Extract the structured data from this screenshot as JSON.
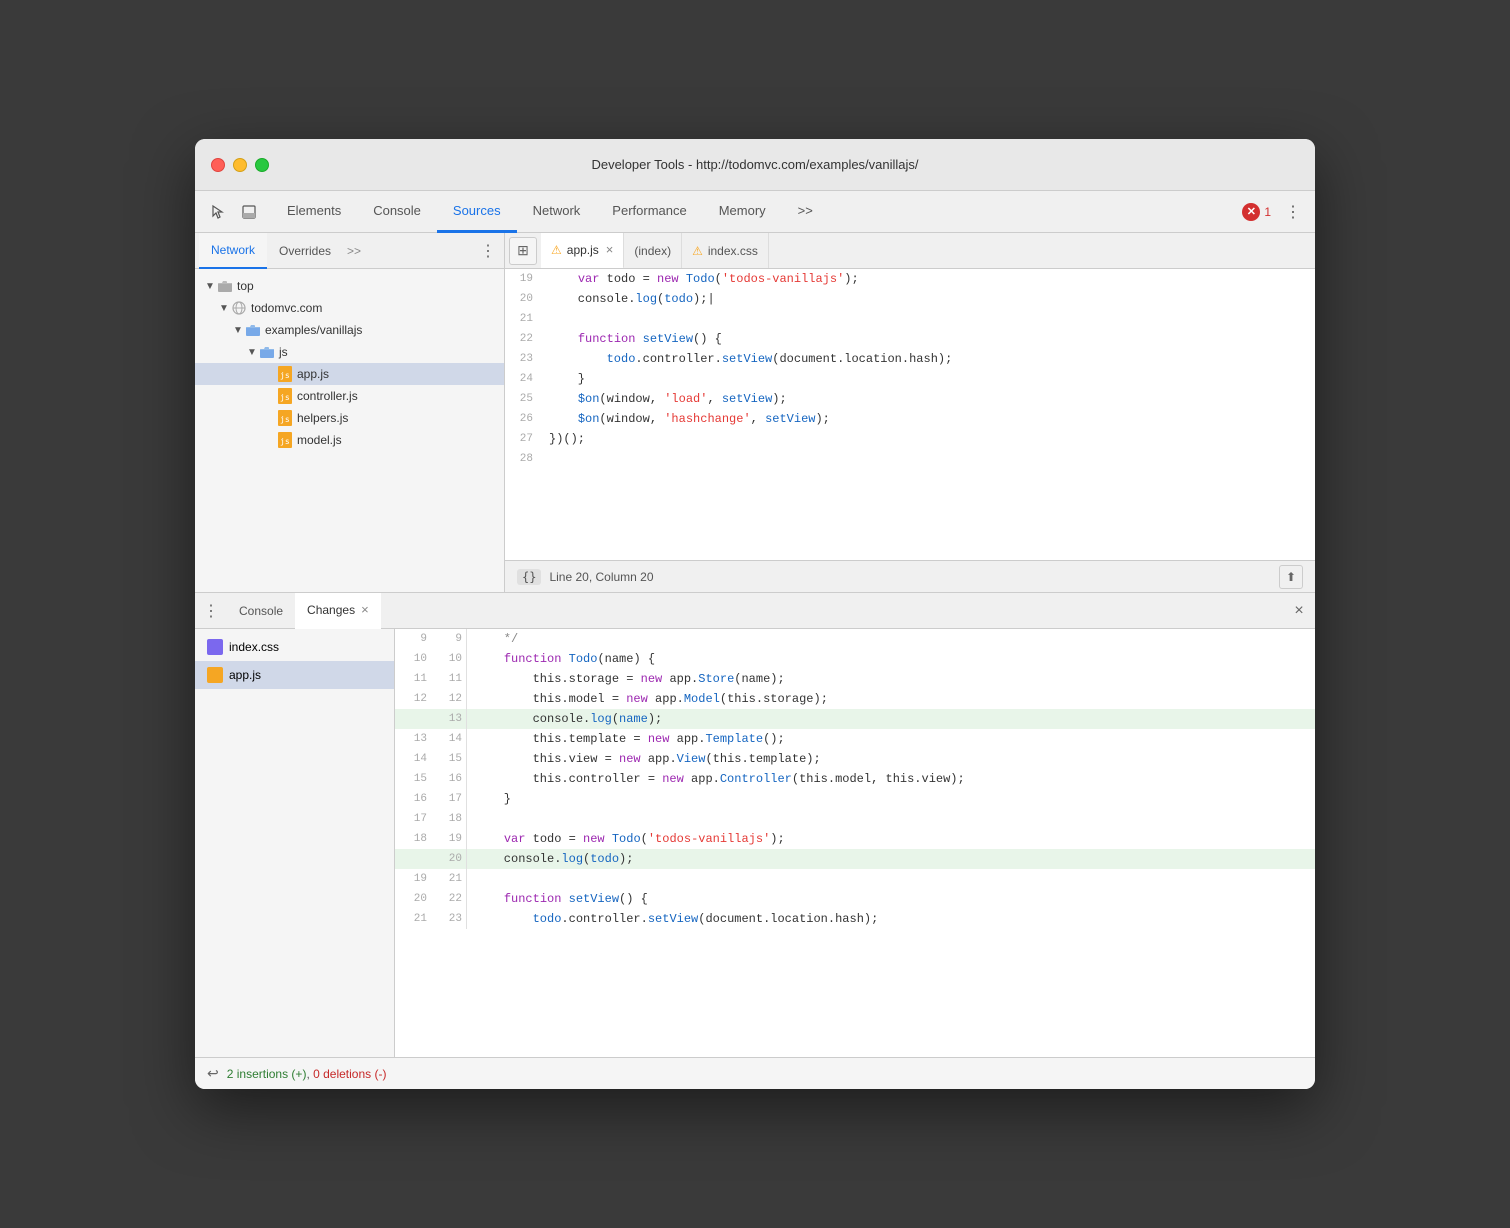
{
  "window": {
    "title": "Developer Tools - http://todomvc.com/examples/vanillajs/",
    "traffic_lights": [
      "red",
      "yellow",
      "green"
    ]
  },
  "toolbar": {
    "tabs": [
      "Elements",
      "Console",
      "Sources",
      "Network",
      "Performance",
      "Memory",
      ">>"
    ],
    "active_tab": "Sources",
    "error_count": "1",
    "more_label": ">>"
  },
  "sidebar": {
    "tabs": [
      "Network",
      "Overrides",
      ">>"
    ],
    "active_tab": "Network",
    "tree": {
      "top": "top",
      "domain": "todomvc.com",
      "folder1": "examples/vanillajs",
      "folder2": "js",
      "file1": "app.js",
      "file2": "controller.js",
      "file3": "helpers.js",
      "file4": "model.js"
    }
  },
  "editor_tabs": [
    {
      "label": "app.js",
      "warning": true,
      "active": true,
      "closeable": true
    },
    {
      "label": "(index)",
      "warning": false,
      "active": false,
      "closeable": false
    },
    {
      "label": "index.css",
      "warning": true,
      "active": false,
      "closeable": false
    }
  ],
  "code_lines": [
    {
      "num": 19,
      "content": "    var todo = new Todo('todos-vanillajs');"
    },
    {
      "num": 20,
      "content": "    console.log(todo);|"
    },
    {
      "num": 21,
      "content": ""
    },
    {
      "num": 22,
      "content": "    function setView() {"
    },
    {
      "num": 23,
      "content": "        todo.controller.setView(document.location.hash);"
    },
    {
      "num": 24,
      "content": "    }"
    },
    {
      "num": 25,
      "content": "    $on(window, 'load', setView);"
    },
    {
      "num": 26,
      "content": "    $on(window, 'hashchange', setView);"
    },
    {
      "num": 27,
      "content": "})();"
    },
    {
      "num": 28,
      "content": ""
    }
  ],
  "status_bar": {
    "braces": "{}",
    "position": "Line 20, Column 20"
  },
  "bottom_panel": {
    "tabs": [
      "Console",
      "Changes"
    ],
    "active_tab": "Changes",
    "close_label": "×"
  },
  "changes_files": [
    {
      "name": "index.css",
      "type": "css",
      "selected": false
    },
    {
      "name": "app.js",
      "type": "js",
      "selected": true
    }
  ],
  "diff_lines": [
    {
      "old": "9",
      "new": "9",
      "content": "    */",
      "added": false
    },
    {
      "old": "10",
      "new": "10",
      "content": "    function Todo(name) {",
      "added": false
    },
    {
      "old": "11",
      "new": "11",
      "content": "        this.storage = new app.Store(name);",
      "added": false
    },
    {
      "old": "12",
      "new": "12",
      "content": "        this.model = new app.Model(this.storage);",
      "added": false
    },
    {
      "old": "",
      "new": "13",
      "content": "        console.log(name);",
      "added": true
    },
    {
      "old": "13",
      "new": "14",
      "content": "        this.template = new app.Template();",
      "added": false
    },
    {
      "old": "14",
      "new": "15",
      "content": "        this.view = new app.View(this.template);",
      "added": false
    },
    {
      "old": "15",
      "new": "16",
      "content": "        this.controller = new app.Controller(this.model, this.view);",
      "added": false
    },
    {
      "old": "16",
      "new": "17",
      "content": "    }",
      "added": false
    },
    {
      "old": "17",
      "new": "18",
      "content": "",
      "added": false
    },
    {
      "old": "18",
      "new": "19",
      "content": "    var todo = new Todo('todos-vanillajs');",
      "added": false
    },
    {
      "old": "",
      "new": "20",
      "content": "    console.log(todo);",
      "added": true
    },
    {
      "old": "19",
      "new": "21",
      "content": "",
      "added": false
    },
    {
      "old": "20",
      "new": "22",
      "content": "    function setView() {",
      "added": false
    },
    {
      "old": "21",
      "new": "23",
      "content": "        todo.controller.setView(document.location.hash);",
      "added": false
    }
  ],
  "bottom_status": {
    "insertions": "2 insertions (+), 0 deletions (-)"
  }
}
